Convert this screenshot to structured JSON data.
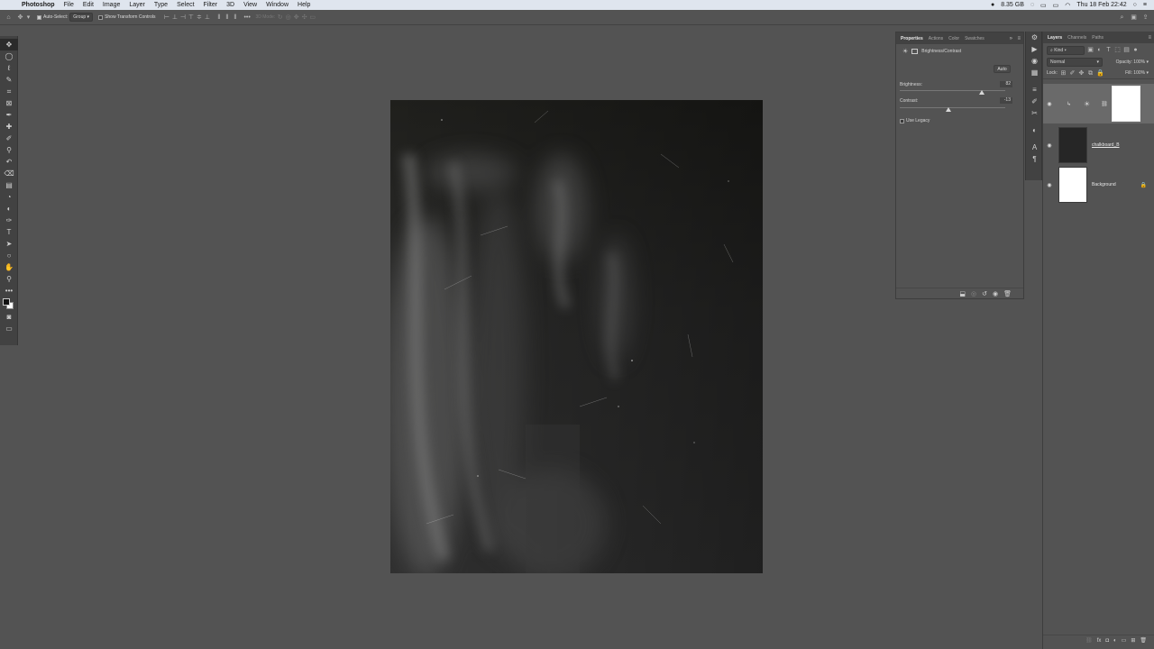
{
  "menubar": {
    "app_name": "Photoshop",
    "items": [
      "File",
      "Edit",
      "Image",
      "Layer",
      "Type",
      "Select",
      "Filter",
      "3D",
      "View",
      "Window",
      "Help"
    ],
    "memory": "8.35 GB",
    "datetime": "Thu 18 Feb  22:42"
  },
  "options": {
    "auto_select_label": "Auto-Select:",
    "auto_select_value": "Group",
    "show_transform_label": "Show Transform Controls",
    "mode_3d_label": "3D Mode:"
  },
  "properties": {
    "tabs": [
      "Properties",
      "Actions",
      "Color",
      "Swatches"
    ],
    "adjustment_title": "Brightness/Contrast",
    "auto_label": "Auto",
    "brightness_label": "Brightness:",
    "brightness_value": "82",
    "contrast_label": "Contrast:",
    "contrast_value": "-13",
    "legacy_label": "Use Legacy",
    "brightness_level_pct": 78,
    "contrast_level_pct": 46
  },
  "layers": {
    "tabs": [
      "Layers",
      "Channels",
      "Paths"
    ],
    "filter_kind": "Kind",
    "blend_mode": "Normal",
    "opacity_label": "Opacity:",
    "opacity_value": "100%",
    "lock_label": "Lock:",
    "fill_label": "Fill:",
    "fill_value": "100%",
    "items": [
      {
        "name": "",
        "type": "adjustment"
      },
      {
        "name": "chalkboard_B",
        "type": "smart-object"
      },
      {
        "name": "Background",
        "type": "background"
      }
    ]
  }
}
